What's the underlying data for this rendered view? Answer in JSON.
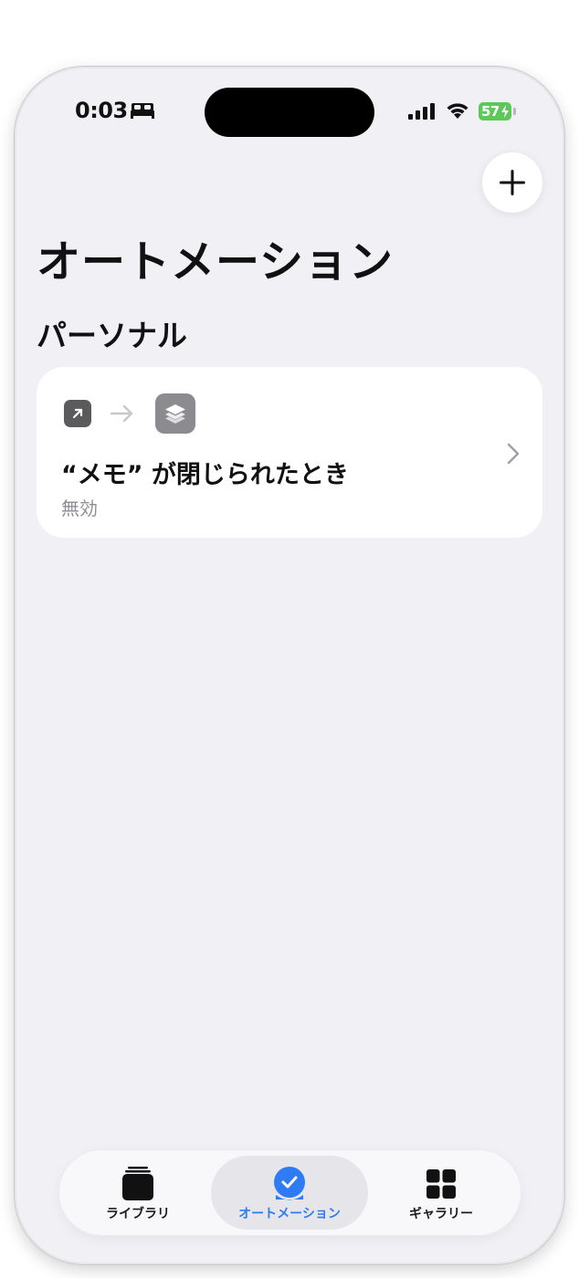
{
  "status_bar": {
    "time": "0:03",
    "battery_level": "57",
    "battery_color": "#5cc85a"
  },
  "header": {
    "add_button_label": "+",
    "title": "オートメーション"
  },
  "section": {
    "title": "パーソナル"
  },
  "automations": [
    {
      "trigger_icon": "open-app-arrow-icon",
      "action_icon": "shortcuts-icon",
      "title": "“メモ” が閉じられたとき",
      "status": "無効"
    }
  ],
  "tab_bar": {
    "accent_color": "#2f7bf6",
    "selected": "オートメーション",
    "tabs": [
      {
        "label": "ライブラリ",
        "icon": "library-stack-icon"
      },
      {
        "label": "オートメーション",
        "icon": "automation-check-icon"
      },
      {
        "label": "ギャラリー",
        "icon": "gallery-grid-icon"
      }
    ]
  }
}
